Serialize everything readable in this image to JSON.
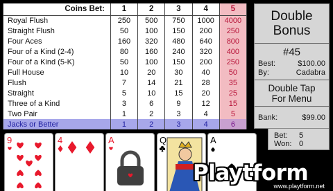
{
  "paytable": {
    "coins_bet_label": "Coins Bet:",
    "columns": [
      "1",
      "2",
      "3",
      "4",
      "5"
    ],
    "rows": [
      {
        "hand": "Royal Flush",
        "pays": [
          "250",
          "500",
          "750",
          "1000",
          "4000"
        ]
      },
      {
        "hand": "Straight Flush",
        "pays": [
          "50",
          "100",
          "150",
          "200",
          "250"
        ]
      },
      {
        "hand": "Four Aces",
        "pays": [
          "160",
          "320",
          "480",
          "640",
          "800"
        ]
      },
      {
        "hand": "Four of a Kind (2-4)",
        "pays": [
          "80",
          "160",
          "240",
          "320",
          "400"
        ]
      },
      {
        "hand": "Four of a Kind (5-K)",
        "pays": [
          "50",
          "100",
          "150",
          "200",
          "250"
        ]
      },
      {
        "hand": "Full House",
        "pays": [
          "10",
          "20",
          "30",
          "40",
          "50"
        ]
      },
      {
        "hand": "Flush",
        "pays": [
          "7",
          "14",
          "21",
          "28",
          "35"
        ]
      },
      {
        "hand": "Straight",
        "pays": [
          "5",
          "10",
          "15",
          "20",
          "25"
        ]
      },
      {
        "hand": "Three of a Kind",
        "pays": [
          "3",
          "6",
          "9",
          "12",
          "15"
        ]
      },
      {
        "hand": "Two Pair",
        "pays": [
          "1",
          "2",
          "3",
          "4",
          "5"
        ]
      },
      {
        "hand": "Jacks or Better",
        "pays": [
          "1",
          "2",
          "3",
          "4",
          "6"
        ]
      }
    ],
    "highlighted_row": "Jacks or Better",
    "highlighted_column": "5"
  },
  "info": {
    "title_line1": "Double",
    "title_line2": "Bonus",
    "game_number": "#45",
    "best_label": "Best:",
    "best_value": "$100.00",
    "by_label": "By:",
    "by_value": "Cadabra",
    "double_tap_line1": "Double Tap",
    "double_tap_line2": "For Menu",
    "bank_label": "Bank:",
    "bank_value": "$99.00"
  },
  "bet_won": {
    "bet_label": "Bet:",
    "bet_value": "5",
    "won_label": "Won:",
    "won_value": "0"
  },
  "cards": [
    {
      "rank": "9",
      "suit": "hearts",
      "held": false
    },
    {
      "rank": "4",
      "suit": "diamonds",
      "held": false
    },
    {
      "rank": "A",
      "suit": "hearts",
      "held": true
    },
    {
      "rank": "Q",
      "suit": "clubs",
      "held": false
    },
    {
      "rank": "A",
      "suit": "spades",
      "held": false
    }
  ],
  "colors": {
    "highlight_row": "#a7a7ea",
    "highlight_column": "#f2bcc2",
    "panel": "#d6d6d6",
    "red_suit": "#e8192c"
  },
  "icons": {
    "hold": "padlock-heart-icon"
  },
  "watermark": {
    "brand": "Playtform",
    "url": "www.playtform.net"
  }
}
